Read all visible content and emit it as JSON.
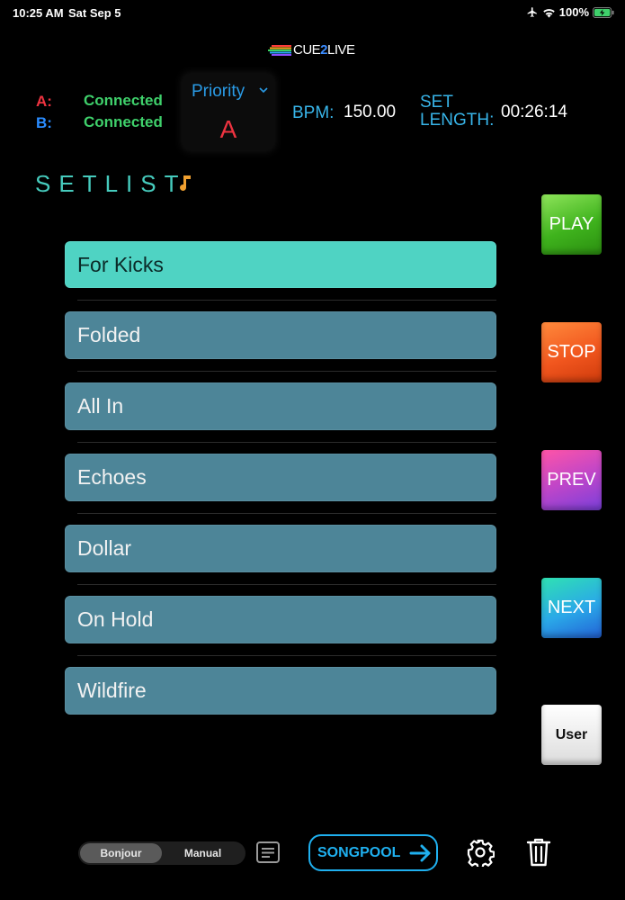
{
  "status_bar": {
    "time": "10:25 AM",
    "date": "Sat Sep 5",
    "battery": "100%"
  },
  "logo": {
    "text_pre": "CUE",
    "text_num": "2",
    "text_post": "LIVE"
  },
  "connection": {
    "a_label": "A:",
    "a_status": "Connected",
    "b_label": "B:",
    "b_status": "Connected"
  },
  "priority": {
    "label": "Priority",
    "value": "A"
  },
  "bpm": {
    "label": "BPM:",
    "value": "150.00"
  },
  "set_length": {
    "label": "SET LENGTH:",
    "value": "00:26:14"
  },
  "setlist": {
    "title": "SETLIST",
    "items": [
      {
        "label": "For Kicks"
      },
      {
        "label": "Folded"
      },
      {
        "label": "All In"
      },
      {
        "label": "Echoes"
      },
      {
        "label": "Dollar"
      },
      {
        "label": "On Hold"
      },
      {
        "label": "Wildfire"
      }
    ]
  },
  "controls": {
    "play": "PLAY",
    "stop": "STOP",
    "prev": "PREV",
    "next": "NEXT",
    "user": "User"
  },
  "bottom_bar": {
    "segments": [
      "Bonjour",
      "Manual"
    ],
    "selected_segment": "Bonjour",
    "songpool_label": "SONGPOOL"
  },
  "colors": {
    "accent_blue": "#1fb0ef",
    "connected_green": "#3fd06b",
    "priority_red": "#ee3340",
    "selected_song": "#4fd3c3",
    "song_item": "#4d8598"
  }
}
